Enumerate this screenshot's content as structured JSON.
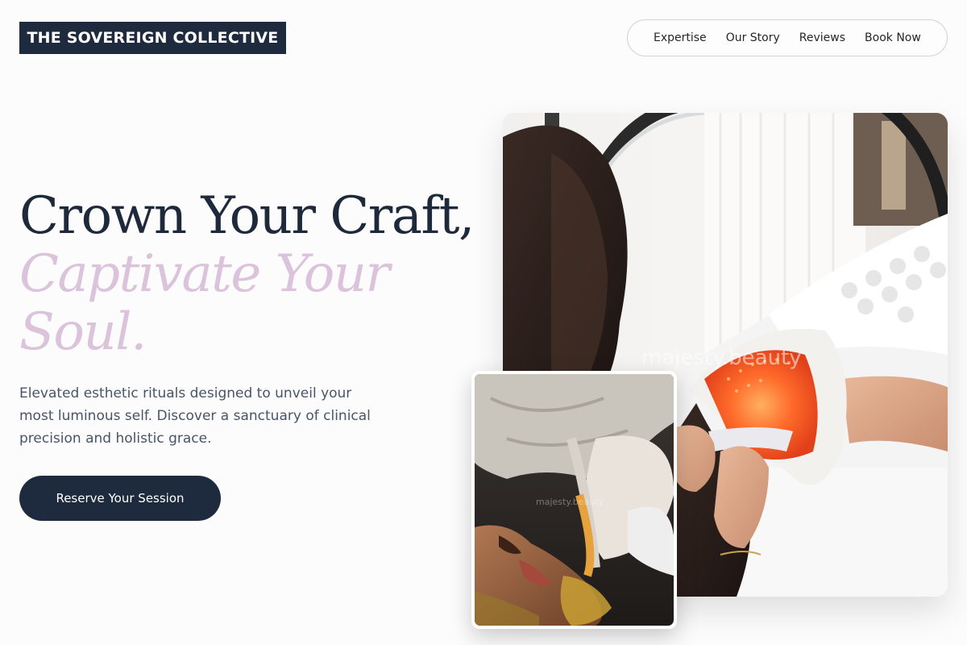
{
  "brand": {
    "name": "THE SOVEREIGN COLLECTIVE"
  },
  "nav": {
    "items": [
      "Expertise",
      "Our Story",
      "Reviews",
      "Book Now"
    ]
  },
  "hero": {
    "headline": "Crown Your Craft,",
    "headline_accent": "Captivate Your Soul.",
    "lead": "Elevated esthetic rituals designed to unveil your most luminous self. Discover a sanctuary of clinical precision and holistic grace.",
    "cta_label": "Reserve Your Session"
  },
  "images": {
    "main_watermark": "majesty.beauty",
    "small_watermark": "majesty.beauty"
  },
  "colors": {
    "navy": "#1e2a3e",
    "accent_lilac": "#dcc3dc",
    "body_text": "#475569"
  }
}
